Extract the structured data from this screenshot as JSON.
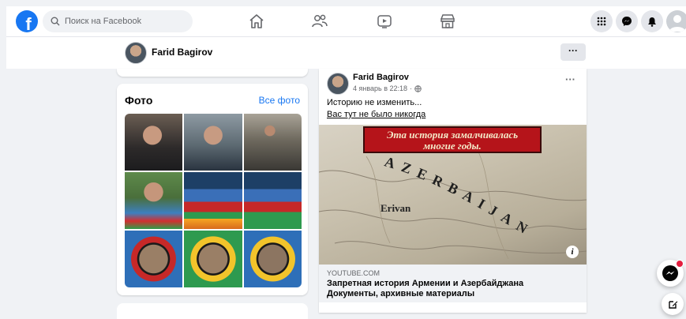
{
  "topnav": {
    "search_placeholder": "Поиск на Facebook",
    "logo_letter": "f"
  },
  "profile_bar": {
    "name": "Farid Bagirov",
    "more_label": "···"
  },
  "photos": {
    "title": "Фото",
    "see_all": "Все фото"
  },
  "post": {
    "author": "Farid Bagirov",
    "date": "4 январь в 22:18",
    "more_label": "···",
    "text_line1": "Историю не изменить...",
    "text_line2": "Вас тут не было никогда",
    "link_image": {
      "banner_line1": "Эта история замалчивалась",
      "banner_line2": "многие годы.",
      "map_word_erivan": "Erivan",
      "map_word_azerbaijan": "AZERBAIJAN",
      "info_badge": "i"
    },
    "link_domain": "YOUTUBE.COM",
    "link_title": "Запретная история Армении и Азербайджана Документы, архивные материалы"
  },
  "colors": {
    "brand_blue": "#1877f2",
    "background": "#f0f2f5",
    "banner_red": "#b5141a",
    "notification_red": "#e41e3f"
  }
}
